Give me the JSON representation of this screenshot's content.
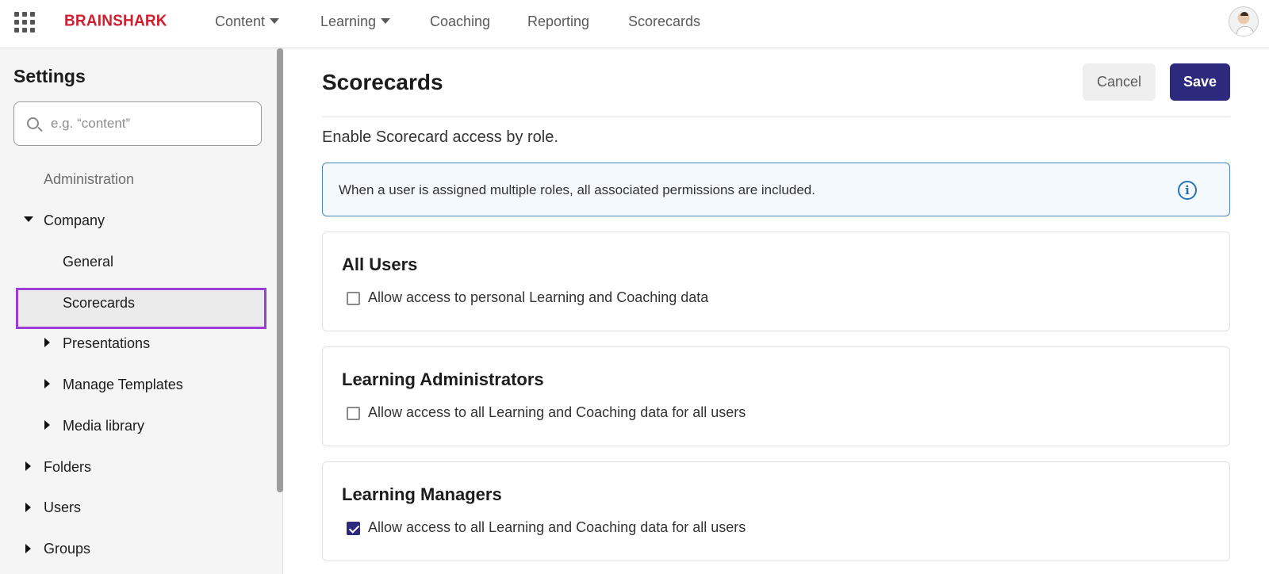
{
  "app": {
    "brand": "BRAINSHARK",
    "accent_color": "#2d2a7e",
    "brand_color": "#d01f2f",
    "highlight_color": "#9b3ed6"
  },
  "nav": {
    "content": "Content",
    "learning": "Learning",
    "coaching": "Coaching",
    "reporting": "Reporting",
    "scorecards": "Scorecards"
  },
  "sidebar": {
    "title": "Settings",
    "search_placeholder": "e.g. “content”",
    "items": {
      "administration": "Administration",
      "company": "Company",
      "general": "General",
      "scorecards": "Scorecards",
      "presentations": "Presentations",
      "manage_templates": "Manage Templates",
      "media_library": "Media library",
      "folders": "Folders",
      "users": "Users",
      "groups": "Groups"
    }
  },
  "main": {
    "title": "Scorecards",
    "cancel_label": "Cancel",
    "save_label": "Save",
    "subtitle": "Enable Scorecard access by role.",
    "info_text": "When a user is assigned multiple roles, all associated permissions are included.",
    "info_icon": "i",
    "roles": [
      {
        "title": "All Users",
        "option": "Allow access to personal Learning and Coaching data",
        "checked": false
      },
      {
        "title": "Learning Administrators",
        "option": "Allow access to all Learning and Coaching data for all users",
        "checked": false
      },
      {
        "title": "Learning Managers",
        "option": "Allow access to all Learning and Coaching data for all users",
        "checked": true
      }
    ]
  }
}
